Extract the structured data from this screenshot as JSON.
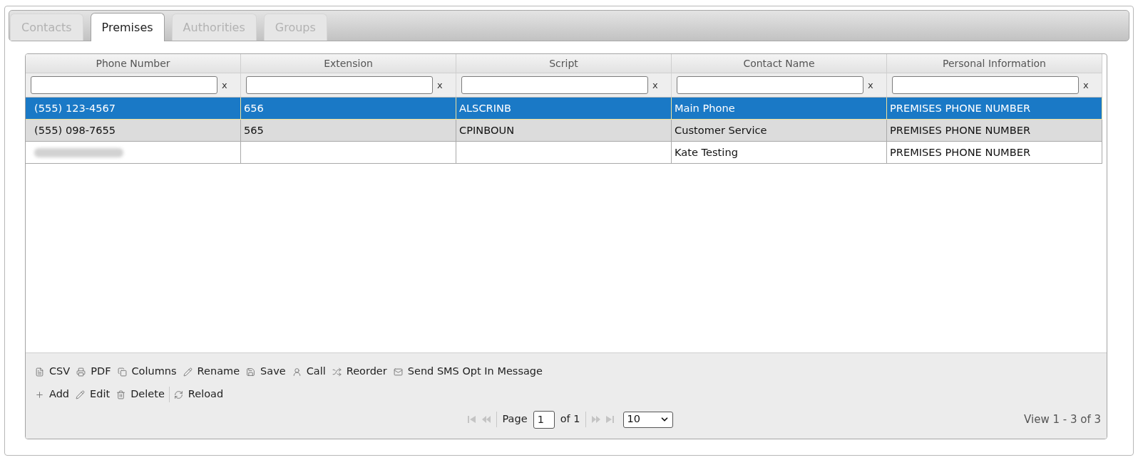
{
  "tabs": [
    {
      "label": "Contacts",
      "selected": false
    },
    {
      "label": "Premises",
      "selected": true
    },
    {
      "label": "Authorities",
      "selected": false
    },
    {
      "label": "Groups",
      "selected": false
    }
  ],
  "grid": {
    "columns": [
      "Phone Number",
      "Extension",
      "Script",
      "Contact Name",
      "Personal Information"
    ],
    "filters": [
      {
        "clear": "x"
      },
      {
        "clear": "x"
      },
      {
        "clear": "x"
      },
      {
        "clear": "x"
      },
      {
        "clear": "x"
      }
    ],
    "rows": [
      {
        "selected": true,
        "hovered": false,
        "cells": [
          {
            "kind": "text",
            "text": "(555) 123-4567"
          },
          {
            "kind": "text",
            "text": "656"
          },
          {
            "kind": "text",
            "text": "ALSCRINB"
          },
          {
            "kind": "text",
            "text": "Main Phone"
          },
          {
            "kind": "text",
            "text": "PREMISES PHONE NUMBER"
          }
        ]
      },
      {
        "selected": false,
        "hovered": true,
        "cells": [
          {
            "kind": "text",
            "text": "(555) 098-7655"
          },
          {
            "kind": "text",
            "text": "565"
          },
          {
            "kind": "text",
            "text": "CPINBOUN"
          },
          {
            "kind": "text",
            "text": "Customer Service"
          },
          {
            "kind": "text",
            "text": "PREMISES PHONE NUMBER"
          }
        ]
      },
      {
        "selected": false,
        "hovered": false,
        "cells": [
          {
            "kind": "redacted"
          },
          {
            "kind": "blank"
          },
          {
            "kind": "blank"
          },
          {
            "kind": "text",
            "text": "Kate Testing"
          },
          {
            "kind": "text",
            "text": "PREMISES PHONE NUMBER"
          }
        ]
      }
    ]
  },
  "toolbar": {
    "rows": [
      {
        "groups": [
          [
            {
              "label": "CSV"
            },
            {
              "label": "PDF"
            },
            {
              "label": "Columns"
            },
            {
              "label": "Rename"
            },
            {
              "label": "Save"
            },
            {
              "label": "Call"
            },
            {
              "label": "Reorder"
            },
            {
              "label": "Send SMS Opt In Message"
            }
          ]
        ]
      },
      {
        "groups": [
          [
            {
              "label": "Add"
            },
            {
              "label": "Edit"
            },
            {
              "label": "Delete"
            }
          ],
          [
            {
              "label": "Reload"
            }
          ]
        ]
      }
    ]
  },
  "pager": {
    "nav": [
      {
        "disabled": true
      },
      {
        "disabled": true
      },
      {
        "disabled": true
      },
      {
        "disabled": true
      }
    ],
    "page_label": "Page",
    "page": "1",
    "total_label": "of 1",
    "page_size": "10",
    "record_info": "View 1 - 3 of 3"
  }
}
